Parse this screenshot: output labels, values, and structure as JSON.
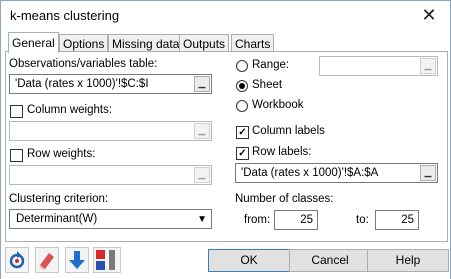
{
  "window": {
    "title": "k-means clustering",
    "close_glyph": "✕"
  },
  "tabs": [
    {
      "label": "General"
    },
    {
      "label": "Options"
    },
    {
      "label": "Missing data"
    },
    {
      "label": "Outputs"
    },
    {
      "label": "Charts"
    }
  ],
  "general": {
    "observations_label": "Observations/variables table:",
    "observations_value": "'Data (rates x 1000)'!$C:$I",
    "column_weights_label": "Column weights:",
    "column_weights_checked": false,
    "column_weights_value": "",
    "row_weights_label": "Row weights:",
    "row_weights_checked": false,
    "row_weights_value": "",
    "criterion_label": "Clustering criterion:",
    "criterion_value": "Determinant(W)",
    "range_label": "Range:",
    "range_value": "",
    "sheet_label": "Sheet",
    "workbook_label": "Workbook",
    "output_selected": "Sheet",
    "column_labels_label": "Column labels",
    "column_labels_checked": true,
    "row_labels_label": "Row labels:",
    "row_labels_checked": true,
    "row_labels_value": "'Data (rates x 1000)'!$A:$A",
    "classes_label": "Number of classes:",
    "from_label": "from:",
    "from_value": "25",
    "to_label": "to:",
    "to_value": "25",
    "picker_glyph": "▁",
    "check_glyph": "✓",
    "dropdown_glyph": "▼"
  },
  "buttons": {
    "ok": "OK",
    "cancel": "Cancel",
    "help": "Help"
  },
  "colors": {
    "reset_icon": "#1f5fb4",
    "eraser_icon": "#d9534f",
    "down_arrow_icon": "#1f6fcc",
    "layout_red": "#d9262c",
    "layout_blue": "#2a4fb0"
  }
}
